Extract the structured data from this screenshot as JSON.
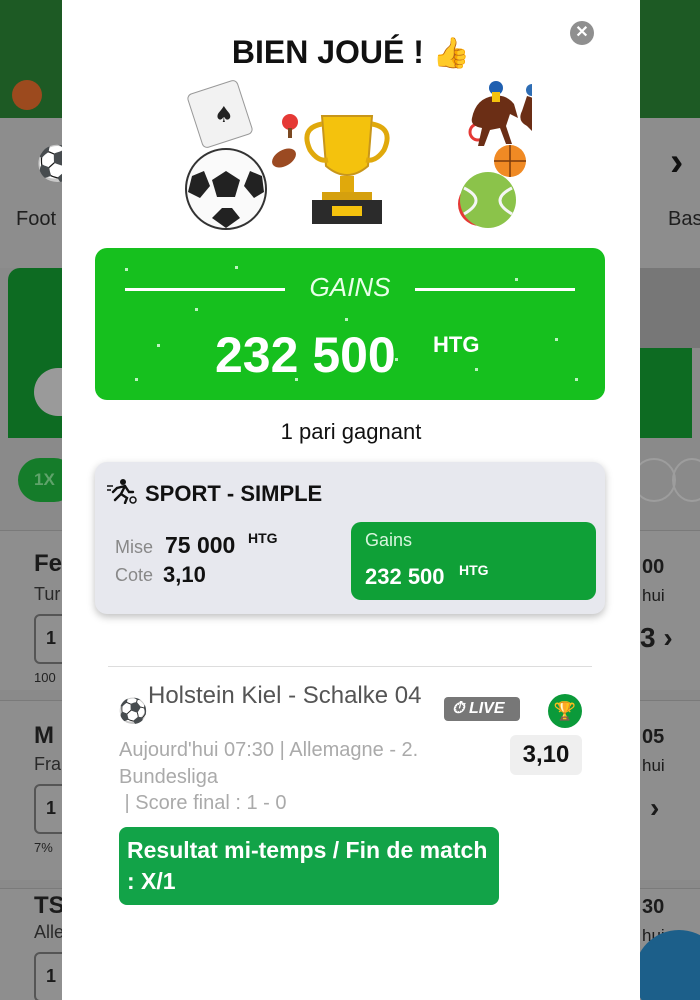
{
  "background": {
    "sport_labels": [
      "Foot",
      "Bas"
    ],
    "chip_label": "1X",
    "rows": [
      {
        "title": "Fe",
        "sub": "Tur",
        "odd": "1",
        "small": "100",
        "right_value": "00",
        "right_sub": "hui"
      },
      {
        "title": "M",
        "sub": "Fra",
        "odd": "1",
        "small": "7%",
        "right_value": "05",
        "right_sub": "hui"
      },
      {
        "title": "TS",
        "sub": "Alle",
        "odd": "1",
        "small": "",
        "right_value": "30",
        "right_sub": "hui"
      }
    ],
    "right_extra": "3"
  },
  "modal": {
    "title": "BIEN JOUÉ !",
    "title_emoji": "👍",
    "close_icon": "✕",
    "gains": {
      "label": "GAINS",
      "amount": "232 500",
      "currency": "HTG"
    },
    "win_count": "1 pari gagnant",
    "bet": {
      "type": "SPORT - SIMPLE",
      "mise_label": "Mise",
      "mise_value": "75 000",
      "mise_currency": "HTG",
      "cote_label": "Cote",
      "cote_value": "3,10",
      "gains_label": "Gains",
      "gains_value": "232 500",
      "gains_currency": "HTG"
    },
    "match": {
      "title": "Holstein Kiel - Schalke 04",
      "live_label": "LIVE",
      "meta": "Aujourd'hui 07:30 |  Allemagne  -  2. Bundesliga",
      "score": " | Score final : 1 - 0",
      "odds": "3,10",
      "result": "Resultat mi-temps / Fin de match : X/1"
    }
  },
  "colors": {
    "gains_green": "#16c01e",
    "inner_green": "#0fa037",
    "result_green": "#12a348",
    "card_grey": "#e7e8ee"
  }
}
